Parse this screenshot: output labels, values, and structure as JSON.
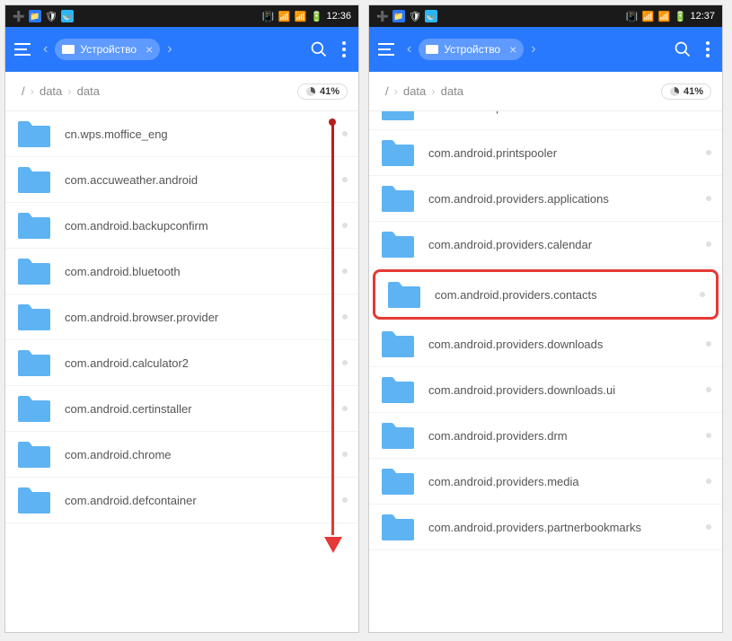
{
  "left": {
    "status": {
      "time": "12:36"
    },
    "tab": {
      "label": "Устройство"
    },
    "breadcrumb": [
      "/",
      "data",
      "data"
    ],
    "storage": "41%",
    "folders": [
      "cn.wps.moffice_eng",
      "com.accuweather.android",
      "com.android.backupconfirm",
      "com.android.bluetooth",
      "com.android.browser.provider",
      "com.android.calculator2",
      "com.android.certinstaller",
      "com.android.chrome",
      "com.android.defcontainer"
    ]
  },
  "right": {
    "status": {
      "time": "12:37"
    },
    "tab": {
      "label": "Устройство"
    },
    "breadcrumb": [
      "/",
      "data",
      "data"
    ],
    "storage": "41%",
    "folders": [
      "com.android.phone",
      "com.android.printspooler",
      "com.android.providers.applications",
      "com.android.providers.calendar",
      "com.android.providers.contacts",
      "com.android.providers.downloads",
      "com.android.providers.downloads.ui",
      "com.android.providers.drm",
      "com.android.providers.media",
      "com.android.providers.partnerbookmarks"
    ],
    "highlight_index": 4
  }
}
